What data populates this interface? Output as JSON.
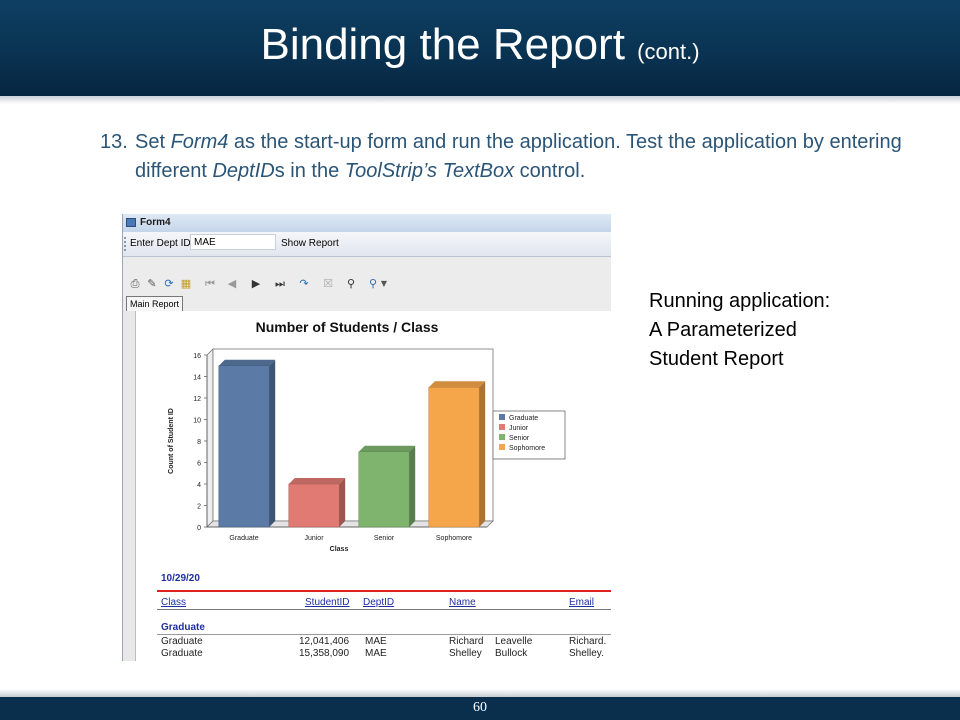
{
  "slide": {
    "title_main": "Binding the Report",
    "title_suffix": "(cont.)",
    "step_number": "13.",
    "step_parts": [
      "Set ",
      "Form4",
      " as the start-up form and run the application. Test the application by entering different ",
      "DeptID",
      "s in the ",
      "ToolStrip’s TextBox",
      " control."
    ],
    "side_note": [
      "Running application:",
      "A Parameterized",
      "Student Report"
    ],
    "page_number": "60"
  },
  "window": {
    "title": "Form4",
    "toolbar": {
      "dept_label": "Enter Dept ID",
      "dept_value": "MAE",
      "show_report_label": "Show Report"
    },
    "viewer_tab": "Main Report",
    "icons": [
      "print-icon",
      "export-icon",
      "refresh-icon",
      "group-tree-icon",
      "first-page-icon",
      "prev-page-icon",
      "next-page-icon",
      "last-page-icon",
      "goto-page-icon",
      "close-view-icon",
      "find-icon",
      "zoom-icon"
    ]
  },
  "report": {
    "date": "10/29/20",
    "columns": [
      "Class",
      "StudentID",
      "DeptID",
      "Name",
      "Email"
    ],
    "group": "Graduate",
    "rows": [
      {
        "class": "Graduate",
        "student_id": "12,041,406",
        "dept": "MAE",
        "first": "Richard",
        "last": "Leavelle",
        "email": "Richard."
      },
      {
        "class": "Graduate",
        "student_id": "15,358,090",
        "dept": "MAE",
        "first": "Shelley",
        "last": "Bullock",
        "email": "Shelley."
      }
    ]
  },
  "chart_data": {
    "type": "bar",
    "title": "Number of Students / Class",
    "xlabel": "Class",
    "ylabel": "Count of Student ID",
    "categories": [
      "Graduate",
      "Junior",
      "Senior",
      "Sophomore"
    ],
    "values": [
      15,
      4,
      7,
      13
    ],
    "colors": [
      "#5b7aa6",
      "#e07a72",
      "#7fb46e",
      "#f5a54a"
    ],
    "ylim": [
      0,
      16
    ],
    "yticks": [
      "0",
      "2",
      "4",
      "6",
      "8",
      "10",
      "12",
      "14",
      "16"
    ],
    "legend": [
      "Graduate",
      "Junior",
      "Senior",
      "Sophomore"
    ],
    "legend_position": "right",
    "grid": false
  }
}
